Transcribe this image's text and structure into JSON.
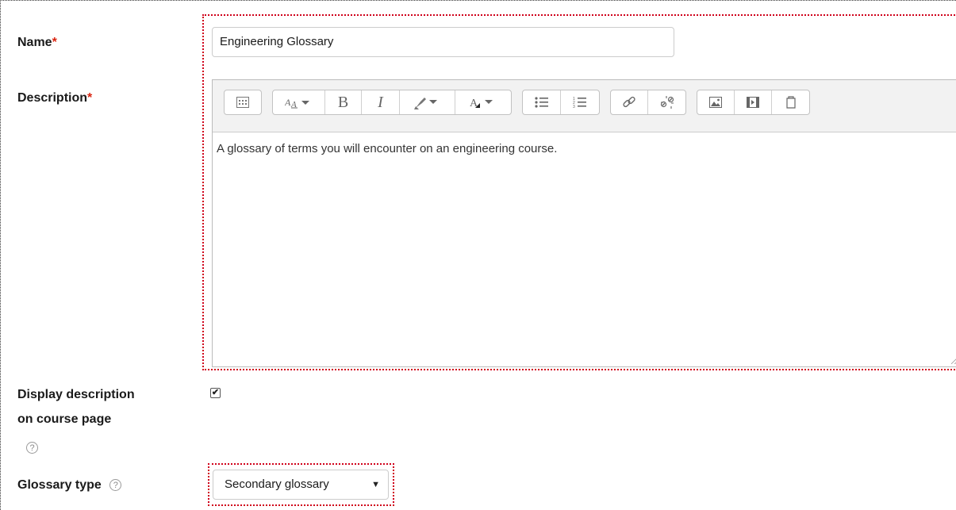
{
  "form": {
    "name_label": "Name",
    "required_mark": "*",
    "name_value": "Engineering Glossary",
    "description_label": "Description",
    "description_text": "A glossary of terms you will encounter on an engineering course.",
    "display_label_line1": "Display description",
    "display_label_line2": "on course page",
    "display_checked": true,
    "check_glyph": "✔",
    "help_glyph": "?",
    "glossary_type_label": "Glossary type",
    "glossary_type_value": "Secondary glossary",
    "select_arrow": "▼"
  },
  "toolbar": {
    "groups": [
      [
        "show-more-buttons-icon"
      ],
      [
        "font-style-icon",
        "bold-icon",
        "italic-icon",
        "text-highlight-icon",
        "font-color-icon"
      ],
      [
        "unordered-list-icon",
        "ordered-list-icon"
      ],
      [
        "link-icon",
        "unlink-icon"
      ],
      [
        "insert-image-icon",
        "insert-media-icon",
        "manage-files-icon"
      ]
    ]
  },
  "colors": {
    "required": "#d9230f",
    "focus_outline": "#d0021b",
    "toolbar_bg": "#f2f2f2"
  }
}
